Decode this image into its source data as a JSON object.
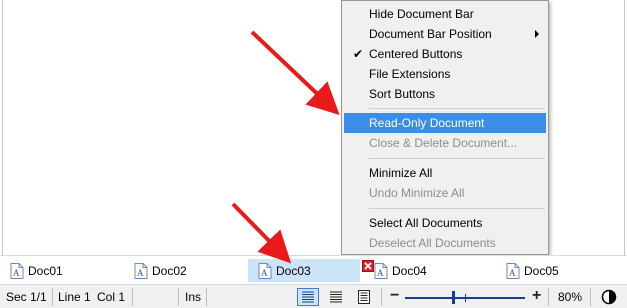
{
  "context_menu": {
    "items": [
      {
        "label": "Hide Document Bar",
        "state": "enabled"
      },
      {
        "label": "Document Bar Position",
        "state": "enabled",
        "submenu": true
      },
      {
        "label": "Centered Buttons",
        "state": "checked"
      },
      {
        "label": "File Extensions",
        "state": "enabled"
      },
      {
        "label": "Sort Buttons",
        "state": "enabled"
      },
      {
        "label": "Read-Only Document",
        "state": "highlighted"
      },
      {
        "label": "Close & Delete Document...",
        "state": "disabled"
      },
      {
        "label": "Minimize All",
        "state": "enabled"
      },
      {
        "label": "Undo Minimize All",
        "state": "disabled"
      },
      {
        "label": "Select All Documents",
        "state": "enabled"
      },
      {
        "label": "Deselect All Documents",
        "state": "disabled"
      }
    ],
    "check_glyph": "✔"
  },
  "document_bar": {
    "tabs": [
      {
        "label": "Doc01",
        "active": false
      },
      {
        "label": "Doc02",
        "active": false
      },
      {
        "label": "Doc03",
        "active": true
      },
      {
        "label": "Doc04",
        "active": false
      },
      {
        "label": "Doc05",
        "active": false
      }
    ],
    "icon": "document-a-icon",
    "close_icon": "red-close-icon"
  },
  "status_bar": {
    "section": "Sec 1/1",
    "line": "Line 1",
    "col": "Col 1",
    "insert_mode": "Ins",
    "zoom": "80%",
    "zoom_level_fraction": 0.4
  },
  "colors": {
    "highlight": "#3a8ee6",
    "active_tab": "#cce4f7",
    "arrow": "#e81a1a",
    "close_red": "#e0202a"
  }
}
